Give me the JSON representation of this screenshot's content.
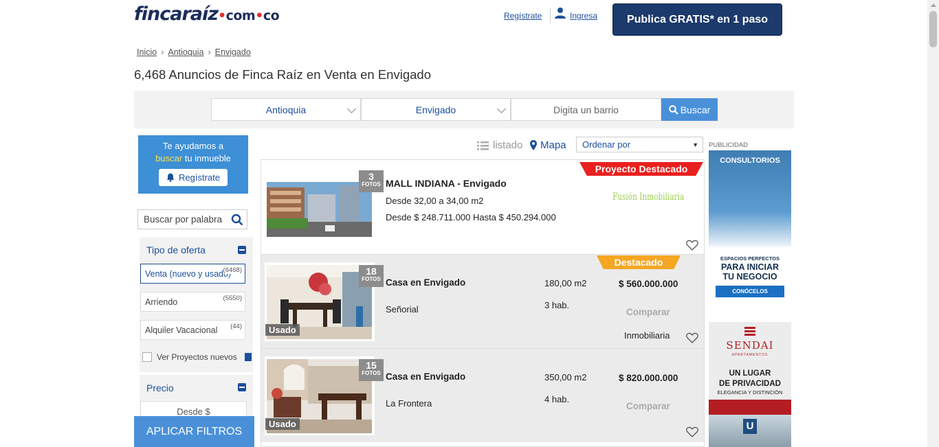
{
  "header": {
    "logo_main": "fincaraíz",
    "logo_dom1": "com",
    "logo_dom2": "co",
    "register_link": "Regístrate",
    "login_link": "Ingresa",
    "publish_button": "Publica GRATIS* en 1 paso"
  },
  "breadcrumb": [
    "Inicio",
    "Antioquia",
    "Envigado"
  ],
  "page_title": "6,468 Anuncios de Finca Raíz en Venta en Envigado",
  "search": {
    "department": "Antioquia",
    "city": "Envigado",
    "barrio_placeholder": "Digita un barrio",
    "button": "Buscar"
  },
  "sidebar": {
    "help_line1": "Te ayudamos a",
    "help_highlight": "buscar",
    "help_rest": " tu inmueble",
    "help_button": "Regístrate",
    "word_search_placeholder": "Buscar por palabra",
    "offer_heading": "Tipo de oferta",
    "offer_options": [
      {
        "label": "Venta (nuevo y usado)",
        "count": "(6468)"
      },
      {
        "label": "Arriendo",
        "count": "(5550)"
      },
      {
        "label": "Alquiler Vacacional",
        "count": "(44)"
      }
    ],
    "new_projects_label": "Ver Proyectos nuevos",
    "price_heading": "Precio",
    "price_from_placeholder": "Desde $",
    "apply_button": "APLICAR FILTROS"
  },
  "toolbar": {
    "list_view": "listado",
    "map_view": "Mapa",
    "order_label": "Ordenar por"
  },
  "listings": [
    {
      "photos_count": "3",
      "photos_label": "FOTOS",
      "badge": "Proyecto Destacado",
      "title": "MALL INDIANA - Envigado",
      "area_range": "Desde 32,00 a 34,00 m2",
      "price_range": "Desde $ 248.711.000 Hasta $ 450.294.000",
      "agency": "Fusión Inmobiliaria"
    },
    {
      "photos_count": "18",
      "photos_label": "FOTOS",
      "badge": "Destacado",
      "condition": "Usado",
      "title": "Casa en Envigado",
      "neighborhood": "Señorial",
      "area": "180,00 m2",
      "rooms": "3 hab.",
      "price": "$ 560.000.000",
      "compare": "Comparar",
      "agency": "Inmobiliaria"
    },
    {
      "photos_count": "15",
      "photos_label": "FOTOS",
      "condition": "Usado",
      "title": "Casa en Envigado",
      "neighborhood": "La Frontera",
      "area": "350,00 m2",
      "rooms": "4 hab.",
      "price": "$ 820.000.000",
      "compare": "Comparar"
    }
  ],
  "ads": {
    "label": "PUBLICIDAD",
    "ad1_title": "CONSULTORIOS",
    "ad1_line1": "ESPACIOS PERFECTOS",
    "ad1_line2": "PARA INICIAR",
    "ad1_line3": "TU NEGOCIO",
    "ad1_cta": "CONÓCELOS",
    "ad2_brand": "SENDAI",
    "ad2_sub": "APARTAMENTOS",
    "ad2_line1": "UN LUGAR",
    "ad2_line2": "DE PRIVACIDAD",
    "ad2_line3": "ELEGANCIA Y DISTINCIÓN",
    "ad2_logo": "U"
  },
  "colors": {
    "brand_navy": "#1c3a6b",
    "link_blue": "#1c4f9c",
    "action_blue": "#4a90d9",
    "badge_red": "#e8201f",
    "badge_orange": "#f5a623"
  }
}
